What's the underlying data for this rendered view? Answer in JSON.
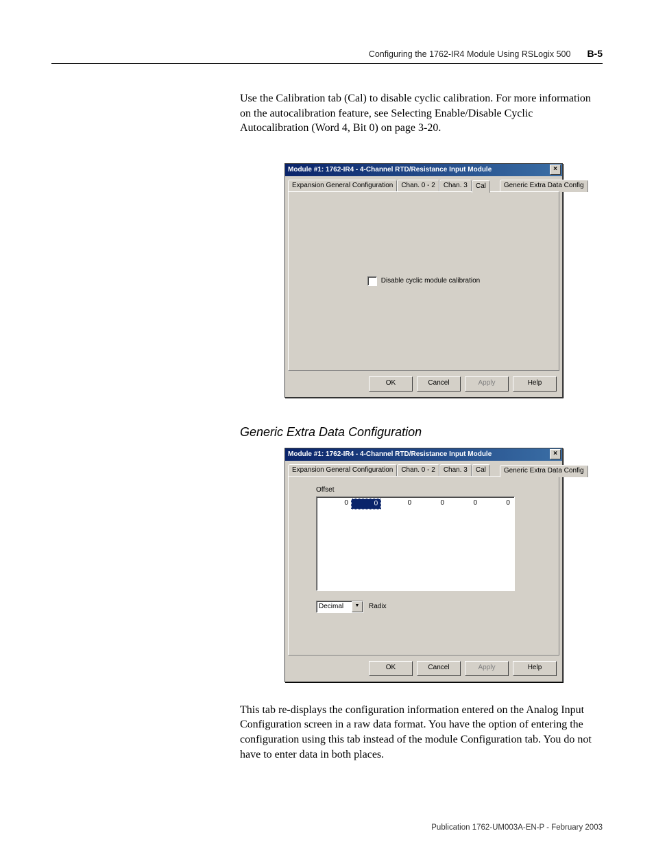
{
  "header": {
    "chapter": "Configuring the 1762-IR4 Module Using RSLogix 500",
    "page_num": "B-5"
  },
  "para1": "Use the Calibration tab (Cal) to disable cyclic calibration. For more information on the autocalibration feature, see Selecting Enable/Disable Cyclic Autocalibration (Word 4, Bit 0) on page 3-20.",
  "dialog1": {
    "title": "Module #1: 1762-IR4 - 4-Channel RTD/Resistance Input Module",
    "tabs": {
      "t0": "Expansion General Configuration",
      "t1": "Chan. 0 - 2",
      "t2": "Chan. 3",
      "t3": "Cal",
      "t4": "Generic Extra Data Config"
    },
    "checkbox_label": "Disable cyclic module calibration",
    "buttons": {
      "ok": "OK",
      "cancel": "Cancel",
      "apply": "Apply",
      "help": "Help"
    }
  },
  "section_heading": "Generic Extra Data Configuration",
  "dialog2": {
    "title": "Module #1: 1762-IR4 - 4-Channel RTD/Resistance Input Module",
    "tabs": {
      "t0": "Expansion General Configuration",
      "t1": "Chan. 0 - 2",
      "t2": "Chan. 3",
      "t3": "Cal",
      "t4": "Generic Extra Data Config"
    },
    "offset_label": "Offset",
    "offset_values": [
      "0",
      "0",
      "0",
      "0",
      "0",
      "0"
    ],
    "radix_selected": "Decimal",
    "radix_label": "Radix",
    "buttons": {
      "ok": "OK",
      "cancel": "Cancel",
      "apply": "Apply",
      "help": "Help"
    }
  },
  "para2": "This tab re-displays the configuration information entered on the Analog Input Configuration screen in a raw data format. You have the option of entering the configuration using this tab instead of the module Configuration tab. You do not have to enter data in both places.",
  "footer": "Publication 1762-UM003A-EN-P - February 2003"
}
